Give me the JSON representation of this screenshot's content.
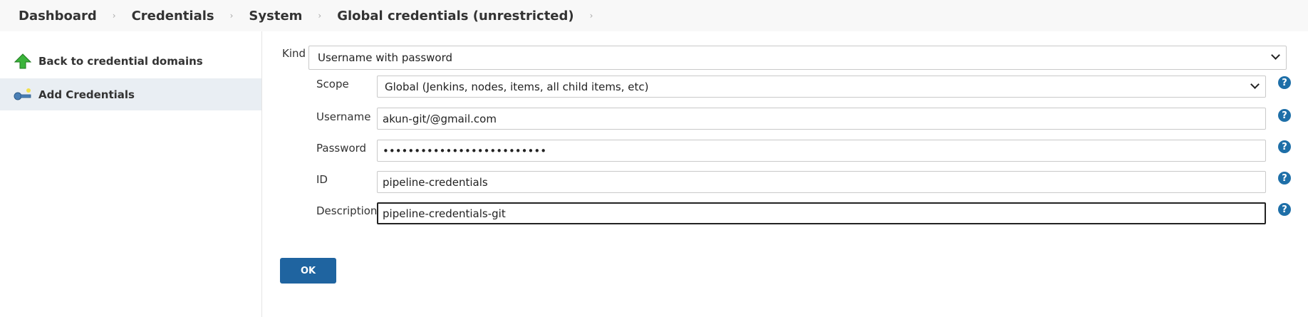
{
  "breadcrumb": {
    "items": [
      "Dashboard",
      "Credentials",
      "System",
      "Global credentials (unrestricted)"
    ],
    "separator": "›"
  },
  "sidebar": {
    "items": [
      {
        "label": "Back to credential domains",
        "icon": "up-arrow-icon"
      },
      {
        "label": "Add Credentials",
        "icon": "key-icon"
      }
    ]
  },
  "form": {
    "kind": {
      "label": "Kind",
      "value": "Username with password"
    },
    "scope": {
      "label": "Scope",
      "value": "Global (Jenkins, nodes, items, all child items, etc)"
    },
    "username": {
      "label": "Username",
      "value": "akun-git/@gmail.com"
    },
    "password": {
      "label": "Password",
      "value": "••••••••••••••••••••••••••"
    },
    "id": {
      "label": "ID",
      "value": "pipeline-credentials"
    },
    "description": {
      "label": "Description",
      "value": "pipeline-credentials-git"
    },
    "help_glyph": "?",
    "ok_label": "OK"
  },
  "colors": {
    "accent": "#1f64a0",
    "help": "#1e6fa8",
    "active_sidebar": "#e9eef3"
  }
}
